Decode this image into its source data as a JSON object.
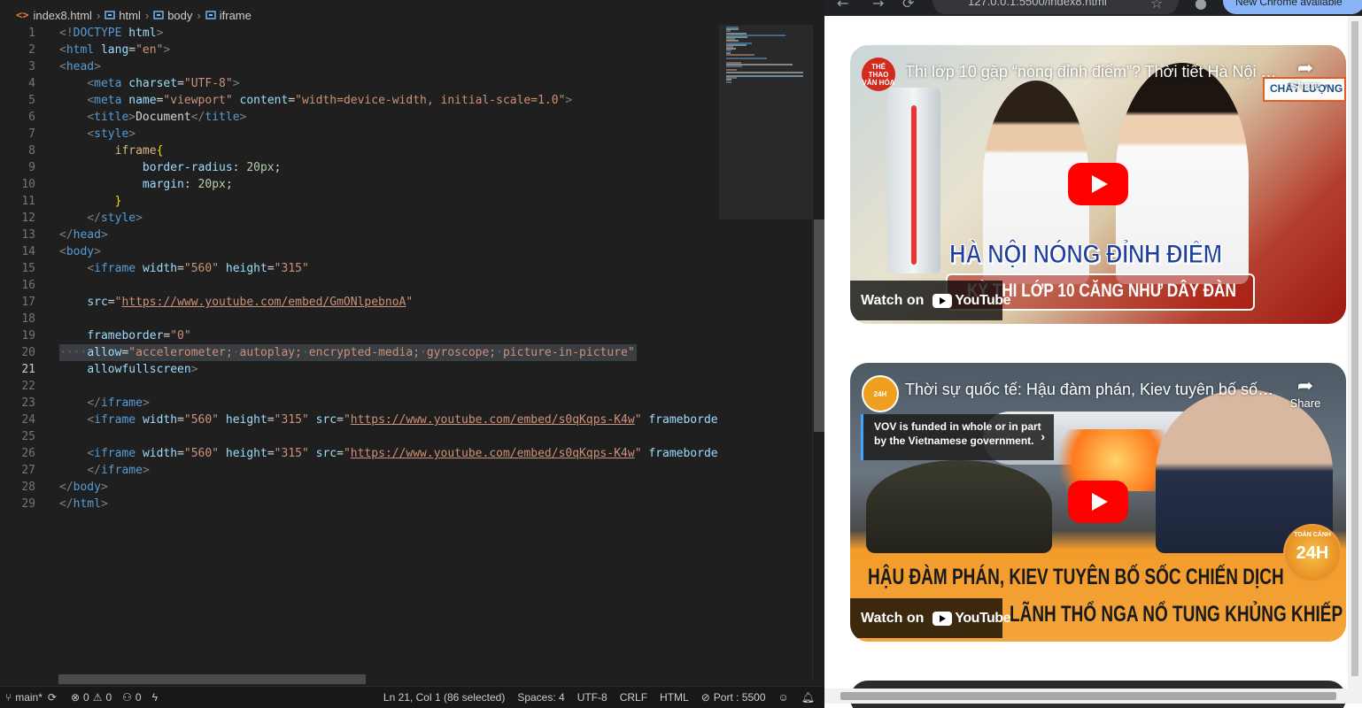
{
  "breadcrumb": {
    "file": "index8.html",
    "items": [
      "html",
      "body",
      "iframe"
    ]
  },
  "code_lines": [
    {
      "n": "1"
    },
    {
      "n": "2"
    },
    {
      "n": "3"
    },
    {
      "n": "4"
    },
    {
      "n": "5"
    },
    {
      "n": "6"
    },
    {
      "n": "7"
    },
    {
      "n": "8"
    },
    {
      "n": "9"
    },
    {
      "n": "10"
    },
    {
      "n": "11"
    },
    {
      "n": "12"
    },
    {
      "n": "13"
    },
    {
      "n": "14"
    },
    {
      "n": "15"
    },
    {
      "n": "16"
    },
    {
      "n": "17"
    },
    {
      "n": "18"
    },
    {
      "n": "19"
    },
    {
      "n": "20"
    },
    {
      "n": "21"
    },
    {
      "n": "22"
    },
    {
      "n": "23"
    },
    {
      "n": "24"
    },
    {
      "n": "25"
    },
    {
      "n": "26"
    },
    {
      "n": "27"
    },
    {
      "n": "28"
    },
    {
      "n": "29"
    }
  ],
  "code": {
    "l1": [
      [
        "t-br",
        "<!"
      ],
      [
        "t-tag",
        "DOCTYPE"
      ],
      [
        "t-txt",
        " "
      ],
      [
        "t-attr",
        "html"
      ],
      [
        "t-br",
        ">"
      ]
    ],
    "l2": [
      [
        "t-br",
        "<"
      ],
      [
        "t-tag",
        "html"
      ],
      [
        "t-txt",
        " "
      ],
      [
        "t-attr",
        "lang"
      ],
      [
        "t-txt",
        "="
      ],
      [
        "t-str",
        "\"en\""
      ],
      [
        "t-br",
        ">"
      ]
    ],
    "l3": [
      [
        "t-br",
        "<"
      ],
      [
        "t-tag",
        "head"
      ],
      [
        "t-br",
        ">"
      ]
    ],
    "l4": [
      [
        "t-txt",
        "    "
      ],
      [
        "t-br",
        "<"
      ],
      [
        "t-tag",
        "meta"
      ],
      [
        "t-txt",
        " "
      ],
      [
        "t-attr",
        "charset"
      ],
      [
        "t-txt",
        "="
      ],
      [
        "t-str",
        "\"UTF-8\""
      ],
      [
        "t-br",
        ">"
      ]
    ],
    "l5": [
      [
        "t-txt",
        "    "
      ],
      [
        "t-br",
        "<"
      ],
      [
        "t-tag",
        "meta"
      ],
      [
        "t-txt",
        " "
      ],
      [
        "t-attr",
        "name"
      ],
      [
        "t-txt",
        "="
      ],
      [
        "t-str",
        "\"viewport\""
      ],
      [
        "t-txt",
        " "
      ],
      [
        "t-attr",
        "content"
      ],
      [
        "t-txt",
        "="
      ],
      [
        "t-str",
        "\"width=device-width, initial-scale=1.0\""
      ],
      [
        "t-br",
        ">"
      ]
    ],
    "l6": [
      [
        "t-txt",
        "    "
      ],
      [
        "t-br",
        "<"
      ],
      [
        "t-tag",
        "title"
      ],
      [
        "t-br",
        ">"
      ],
      [
        "t-txt",
        "Document"
      ],
      [
        "t-br",
        "</"
      ],
      [
        "t-tag",
        "title"
      ],
      [
        "t-br",
        ">"
      ]
    ],
    "l7": [
      [
        "t-txt",
        "    "
      ],
      [
        "t-br",
        "<"
      ],
      [
        "t-tag",
        "style"
      ],
      [
        "t-br",
        ">"
      ]
    ],
    "l8": [
      [
        "t-txt",
        "        "
      ],
      [
        "t-sel",
        "iframe"
      ],
      [
        "t-brace",
        "{"
      ]
    ],
    "l9": [
      [
        "t-txt",
        "            "
      ],
      [
        "t-prop",
        "border-radius"
      ],
      [
        "t-txt",
        ": "
      ],
      [
        "t-num",
        "20px"
      ],
      [
        "t-txt",
        ";"
      ]
    ],
    "l10": [
      [
        "t-txt",
        "            "
      ],
      [
        "t-prop",
        "margin"
      ],
      [
        "t-txt",
        ": "
      ],
      [
        "t-num",
        "20px"
      ],
      [
        "t-txt",
        ";"
      ]
    ],
    "l11": [
      [
        "t-txt",
        "        "
      ],
      [
        "t-brace",
        "}"
      ]
    ],
    "l12": [
      [
        "t-txt",
        "    "
      ],
      [
        "t-br",
        "</"
      ],
      [
        "t-tag",
        "style"
      ],
      [
        "t-br",
        ">"
      ]
    ],
    "l13": [
      [
        "t-br",
        "</"
      ],
      [
        "t-tag",
        "head"
      ],
      [
        "t-br",
        ">"
      ]
    ],
    "l14": [
      [
        "t-br",
        "<"
      ],
      [
        "t-tag",
        "body"
      ],
      [
        "t-br",
        ">"
      ]
    ],
    "l15": [
      [
        "t-txt",
        "    "
      ],
      [
        "t-br",
        "<"
      ],
      [
        "t-tag",
        "iframe"
      ],
      [
        "t-txt",
        " "
      ],
      [
        "t-attr",
        "width"
      ],
      [
        "t-txt",
        "="
      ],
      [
        "t-str",
        "\"560\""
      ],
      [
        "t-txt",
        " "
      ],
      [
        "t-attr",
        "height"
      ],
      [
        "t-txt",
        "="
      ],
      [
        "t-str",
        "\"315\""
      ]
    ],
    "l16": [],
    "l17": [
      [
        "t-txt",
        "    "
      ],
      [
        "t-attr",
        "src"
      ],
      [
        "t-txt",
        "="
      ],
      [
        "t-str",
        "\""
      ],
      [
        "t-link",
        "https://www.youtube.com/embed/GmONlpebnoA"
      ],
      [
        "t-str",
        "\""
      ]
    ],
    "l18": [],
    "l19": [
      [
        "t-txt",
        "    "
      ],
      [
        "t-attr",
        "frameborder"
      ],
      [
        "t-txt",
        "="
      ],
      [
        "t-str",
        "\"0\""
      ]
    ],
    "l20": [
      [
        "t-ws",
        "····"
      ],
      [
        "t-attr",
        "allow"
      ],
      [
        "t-txt",
        "="
      ],
      [
        "t-str",
        "\"accelerometer;"
      ],
      [
        "t-ws",
        "·"
      ],
      [
        "t-str",
        "autoplay;"
      ],
      [
        "t-ws",
        "·"
      ],
      [
        "t-str",
        "encrypted-media;"
      ],
      [
        "t-ws",
        "·"
      ],
      [
        "t-str",
        "gyroscope;"
      ],
      [
        "t-ws",
        "·"
      ],
      [
        "t-str",
        "picture-in-picture\""
      ]
    ],
    "l21": [
      [
        "t-txt",
        "    "
      ],
      [
        "t-attr",
        "allowfullscreen"
      ],
      [
        "t-br",
        ">"
      ]
    ],
    "l22": [],
    "l23": [
      [
        "t-txt",
        "    "
      ],
      [
        "t-br",
        "</"
      ],
      [
        "t-tag",
        "iframe"
      ],
      [
        "t-br",
        ">"
      ]
    ],
    "l24": [
      [
        "t-txt",
        "    "
      ],
      [
        "t-br",
        "<"
      ],
      [
        "t-tag",
        "iframe"
      ],
      [
        "t-txt",
        " "
      ],
      [
        "t-attr",
        "width"
      ],
      [
        "t-txt",
        "="
      ],
      [
        "t-str",
        "\"560\""
      ],
      [
        "t-txt",
        " "
      ],
      [
        "t-attr",
        "height"
      ],
      [
        "t-txt",
        "="
      ],
      [
        "t-str",
        "\"315\""
      ],
      [
        "t-txt",
        " "
      ],
      [
        "t-attr",
        "src"
      ],
      [
        "t-txt",
        "="
      ],
      [
        "t-str",
        "\""
      ],
      [
        "t-link",
        "https://www.youtube.com/embed/s0qKqps-K4w"
      ],
      [
        "t-str",
        "\""
      ],
      [
        "t-txt",
        " "
      ],
      [
        "t-attr",
        "frameborder"
      ],
      [
        "t-txt",
        "="
      ]
    ],
    "l25": [],
    "l26": [
      [
        "t-txt",
        "    "
      ],
      [
        "t-br",
        "<"
      ],
      [
        "t-tag",
        "iframe"
      ],
      [
        "t-txt",
        " "
      ],
      [
        "t-attr",
        "width"
      ],
      [
        "t-txt",
        "="
      ],
      [
        "t-str",
        "\"560\""
      ],
      [
        "t-txt",
        " "
      ],
      [
        "t-attr",
        "height"
      ],
      [
        "t-txt",
        "="
      ],
      [
        "t-str",
        "\"315\""
      ],
      [
        "t-txt",
        " "
      ],
      [
        "t-attr",
        "src"
      ],
      [
        "t-txt",
        "="
      ],
      [
        "t-str",
        "\""
      ],
      [
        "t-link",
        "https://www.youtube.com/embed/s0qKqps-K4w"
      ],
      [
        "t-str",
        "\""
      ],
      [
        "t-txt",
        " "
      ],
      [
        "t-attr",
        "frameborder"
      ],
      [
        "t-txt",
        "="
      ]
    ],
    "l27": [
      [
        "t-txt",
        "    "
      ],
      [
        "t-br",
        "</"
      ],
      [
        "t-tag",
        "iframe"
      ],
      [
        "t-br",
        ">"
      ]
    ],
    "l28": [
      [
        "t-br",
        "</"
      ],
      [
        "t-tag",
        "body"
      ],
      [
        "t-br",
        ">"
      ]
    ],
    "l29": [
      [
        "t-br",
        "</"
      ],
      [
        "t-tag",
        "html"
      ],
      [
        "t-br",
        ">"
      ]
    ]
  },
  "statusbar": {
    "branch": "main*",
    "errors": "0",
    "warnings": "0",
    "ports": "0",
    "position": "Ln 21, Col 1 (86 selected)",
    "spaces": "Spaces: 4",
    "encoding": "UTF-8",
    "eol": "CRLF",
    "language": "HTML",
    "port": "Port : 5500"
  },
  "browser": {
    "url": "127.0.0.1:5500/index8.html",
    "update_label": "New Chrome available",
    "videos": [
      {
        "title": "Thi lớp 10 gặp “nóng đỉnh điểm”? Thời tiết Hà Nội d...",
        "avatar_text": "THỂ THAO VĂN HÓA",
        "share": "Share",
        "watch_on": "Watch on",
        "youtube": "YouTube",
        "headline1": "HÀ NỘI NÓNG ĐỈNH ĐIỂM",
        "headline2": "KỲ THI LỚP 10 CĂNG NHƯ DÂY ĐÀN",
        "sign": "CHẤT LƯỢNG"
      },
      {
        "title": "Thời sự quốc tế: Hậu đàm phán, Kiev tuyên bố sốc ...",
        "avatar_text": "24H",
        "share": "Share",
        "watch_on": "Watch on",
        "youtube": "YouTube",
        "vov_line1": "VOV is funded in whole or in part",
        "vov_line2": "by the Vietnamese government.",
        "headline1": "HẬU ĐÀM PHÁN, KIEV TUYÊN BỐ SỐC CHIẾN DỊCH",
        "headline2": "LÃNH THỔ NGA NỔ TUNG KHỦNG KHIẾP",
        "badge": "24H",
        "badge_caption": "TOÀN CẢNH"
      }
    ]
  }
}
